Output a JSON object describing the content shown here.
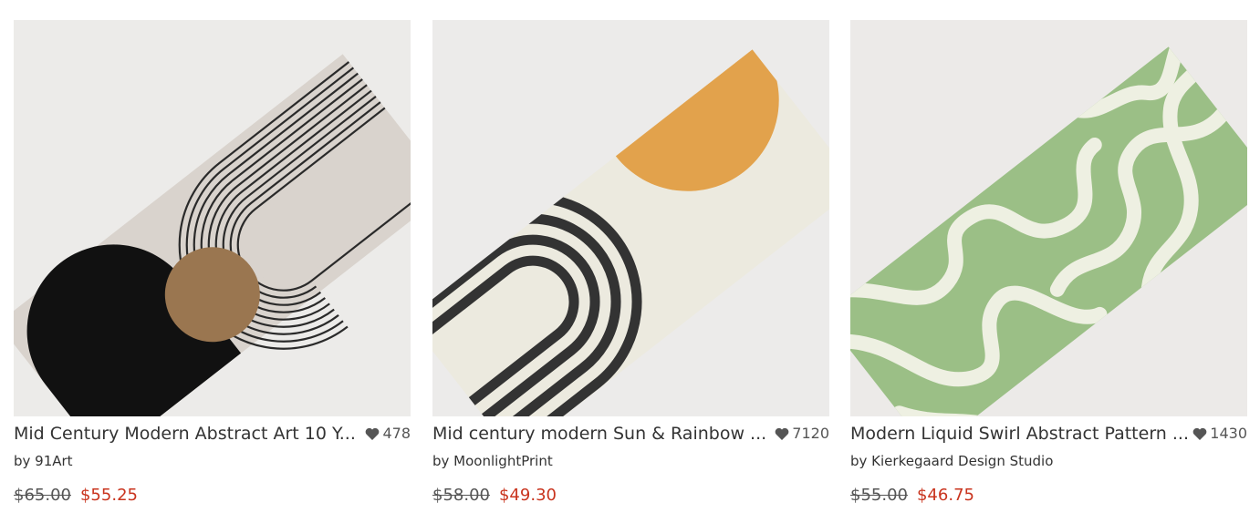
{
  "products": [
    {
      "title": "Mid Century Modern Abstract Art 10 Y...",
      "artist": "by 91Art",
      "favorites": "478",
      "original_price": "$65.00",
      "sale_price": "$55.25",
      "image_icon": "yoga-mat-image"
    },
    {
      "title": "Mid century modern Sun & Rainbow ...",
      "artist": "by MoonlightPrint",
      "favorites": "7120",
      "original_price": "$58.00",
      "sale_price": "$49.30",
      "image_icon": "yoga-mat-image"
    },
    {
      "title": "Modern Liquid Swirl Abstract Pattern ...",
      "artist": "by Kierkegaard Design Studio",
      "favorites": "1430",
      "original_price": "$55.00",
      "sale_price": "$46.75",
      "image_icon": "yoga-mat-image"
    }
  ],
  "colors": {
    "sale_price": "#c9341e",
    "image_bg": "#ececea",
    "sage_green": "#9bbf86",
    "sun_orange": "#e2a24c"
  },
  "icons": {
    "favorite": "heart-icon"
  }
}
